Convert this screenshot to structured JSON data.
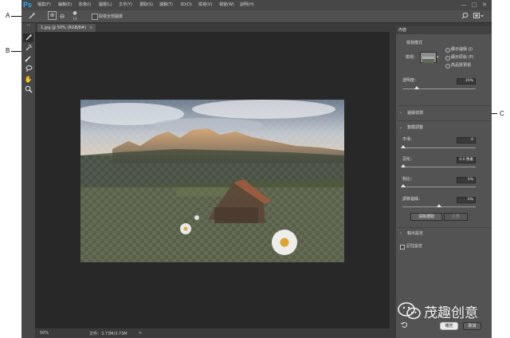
{
  "callouts": {
    "a": "A",
    "b": "B",
    "c": "C"
  },
  "app": {
    "logo": "Ps",
    "menu": [
      "檔案(F)",
      "編輯(E)",
      "影像(I)",
      "圖層(L)",
      "文字(Y)",
      "選取(S)",
      "濾鏡(T)",
      "3D(D)",
      "檢視(V)",
      "視窗(W)",
      "說明(H)"
    ],
    "window_controls": {
      "minimize": "—",
      "maximize": "□",
      "close": "✕"
    }
  },
  "options": {
    "brush_size": "13",
    "sample_all_layers": "取樣全部圖層"
  },
  "document": {
    "tab_title": "1.jpg @ 50% (RGB/8#)",
    "tab_close": "×",
    "zoom": "50%",
    "file_info": "文件：3.73M/3.73M",
    "status_arrow": ">"
  },
  "panel": {
    "title": "內容",
    "view_mode": {
      "heading": "檢視模式",
      "label": "檢視：",
      "options": [
        "顯示邊緣 (J)",
        "顯示原始 (P)",
        "高品質預視"
      ]
    },
    "opacity": {
      "label": "透明度：",
      "value": "20%",
      "level_percent": 20
    },
    "edge_detection": {
      "label": "邊緣偵測"
    },
    "global_refinements": {
      "label": "整體調整",
      "smooth": {
        "label": "平滑：",
        "value": "0"
      },
      "feather": {
        "label": "羽化：",
        "value": "0.0 像素"
      },
      "contrast": {
        "label": "對比：",
        "value": "0%"
      },
      "shift_edge": {
        "label": "調移邊緣：",
        "value": "0%",
        "level_percent": 50
      },
      "clear_selection": "清除選取",
      "invert": "反轉"
    },
    "output_settings": {
      "label": "輸出設定"
    },
    "remember_settings": "記住設定",
    "ok": "確定",
    "cancel": "取消"
  },
  "watermark": {
    "text": "茂趣创意"
  }
}
